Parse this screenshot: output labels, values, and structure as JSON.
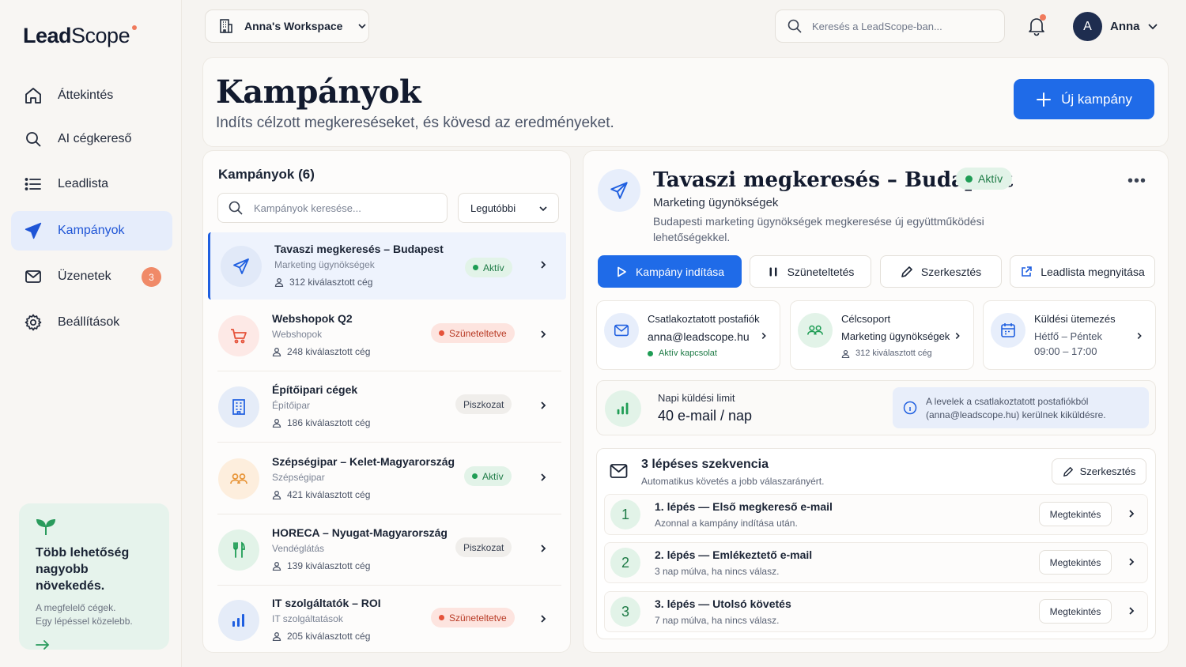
{
  "app": {
    "logo_bold": "Lead",
    "logo_light": "Scope"
  },
  "colors": {
    "accent": "#1f6be8",
    "active_nav_bg": "#e6edfb",
    "green": "#1f9d55",
    "red": "#e5533b",
    "badge_orange": "#f08a68"
  },
  "sidebar": {
    "items": [
      {
        "label": "Áttekintés",
        "icon": "home-icon"
      },
      {
        "label": "AI cégkereső",
        "icon": "search-icon"
      },
      {
        "label": "Leadlista",
        "icon": "list-icon"
      },
      {
        "label": "Kampányok",
        "icon": "send-icon",
        "active": true
      },
      {
        "label": "Üzenetek",
        "icon": "mail-icon",
        "badge": "3"
      },
      {
        "label": "Beállítások",
        "icon": "gear-icon"
      }
    ],
    "promo": {
      "title": "Több lehetőség nagyobb növekedés.",
      "line1": "A megfelelő cégek.",
      "line2": "Egy lépéssel közelebb.",
      "icon": "sprout-icon"
    }
  },
  "topbar": {
    "workspace": "Anna's Workspace",
    "search_placeholder": "Keresés a LeadScope-ban...",
    "avatar_initial": "A",
    "user_name": "Anna"
  },
  "header": {
    "title": "Kampányok",
    "subtitle": "Indíts célzott megkereséseket, és kövesd az eredményeket.",
    "new_button": "Új kampány"
  },
  "list": {
    "heading": "Kampányok (6)",
    "search_placeholder": "Kampányok keresése...",
    "sort": "Legutóbbi",
    "campaigns": [
      {
        "name": "Tavaszi megkeresés – Budapest",
        "sector": "Marketing ügynökségek",
        "count": "312 kiválasztott cég",
        "status": "Aktív",
        "status_type": "green",
        "icon": "send-icon",
        "selected": true
      },
      {
        "name": "Webshopok Q2",
        "sector": "Webshopok",
        "count": "248 kiválasztott cég",
        "status": "Szüneteltetve",
        "status_type": "red",
        "icon": "cart-icon"
      },
      {
        "name": "Építőipari cégek",
        "sector": "Építőipar",
        "count": "186 kiválasztott cég",
        "status": "Piszkozat",
        "status_type": "gray",
        "icon": "building-icon"
      },
      {
        "name": "Szépségipar – Kelet-Magyarország",
        "sector": "Szépségipar",
        "count": "421 kiválasztott cég",
        "status": "Aktív",
        "status_type": "green",
        "icon": "people-icon"
      },
      {
        "name": "HORECA – Nyugat-Magyarország",
        "sector": "Vendéglátás",
        "count": "139 kiválasztott cég",
        "status": "Piszkozat",
        "status_type": "gray",
        "icon": "cutlery-icon"
      },
      {
        "name": "IT szolgáltatók – ROI",
        "sector": "IT szolgáltatások",
        "count": "205 kiválasztott cég",
        "status": "Szüneteltetve",
        "status_type": "red",
        "icon": "chart-icon"
      }
    ]
  },
  "detail": {
    "title": "Tavaszi megkeresés – Budapest",
    "status": "Aktív",
    "category": "Marketing ügynökségek",
    "description": "Budapesti marketing ügynökségek megkeresése új együttműködési lehetőségekkel.",
    "actions": {
      "start": "Kampány indítása",
      "pause": "Szüneteltetés",
      "edit": "Szerkesztés",
      "open_list": "Leadlista megnyitása"
    },
    "mailbox": {
      "label": "Csatlakoztatott postafiók",
      "email": "anna@leadscope.hu",
      "status": "Aktív kapcsolat"
    },
    "audience": {
      "label": "Célcsoport",
      "value": "Marketing ügynökségek",
      "count": "312 kiválasztott cég"
    },
    "schedule": {
      "label": "Küldési ütemezés",
      "days": "Hétfő – Péntek",
      "hours": "09:00 – 17:00"
    },
    "limit": {
      "label": "Napi küldési limit",
      "value": "40 e-mail / nap",
      "info": "A levelek a csatlakoztatott postafiókból (anna@leadscope.hu) kerülnek kiküldésre."
    },
    "sequence": {
      "title": "3 lépéses szekvencia",
      "subtitle": "Automatikus követés a jobb válaszarányért.",
      "edit": "Szerkesztés",
      "preview_label": "Megtekintés",
      "steps": [
        {
          "num": "1",
          "title": "1. lépés — Első megkereső e-mail",
          "sub": "Azonnal a kampány indítása után."
        },
        {
          "num": "2",
          "title": "2. lépés — Emlékeztető e-mail",
          "sub": "3 nap múlva, ha nincs válasz."
        },
        {
          "num": "3",
          "title": "3. lépés — Utolsó követés",
          "sub": "7 nap múlva, ha nincs válasz."
        }
      ]
    }
  }
}
